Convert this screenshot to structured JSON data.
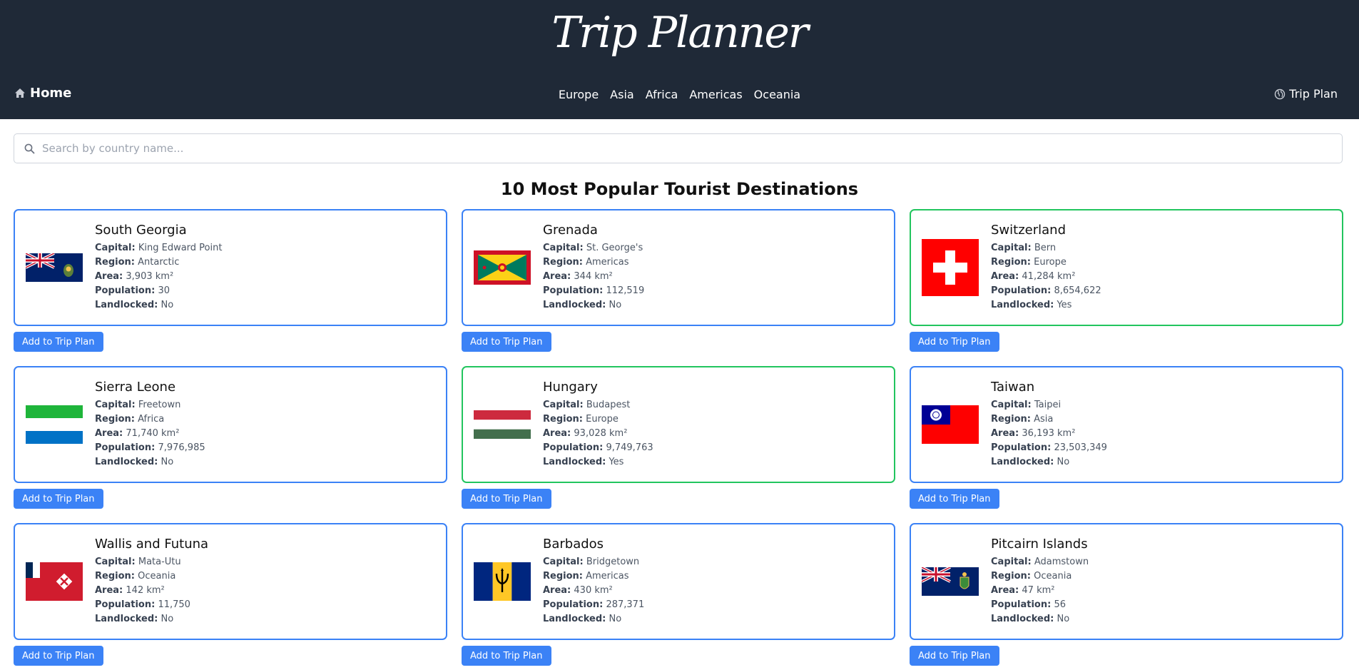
{
  "header": {
    "brand": "Trip Planner",
    "home_label": "Home",
    "nav": [
      "Europe",
      "Asia",
      "Africa",
      "Americas",
      "Oceania"
    ],
    "trip_plan_label": "Trip Plan"
  },
  "search": {
    "placeholder": "Search by country name..."
  },
  "section_title": "10 Most Popular Tourist Destinations",
  "field_labels": {
    "capital": "Capital:",
    "region": "Region:",
    "area": "Area:",
    "population": "Population:",
    "landlocked": "Landlocked:"
  },
  "add_button_label": "Add to Trip Plan",
  "colors": {
    "header_bg": "#1f2937",
    "accent_blue": "#3b82f6",
    "accent_green": "#22c55e"
  },
  "countries": [
    {
      "name": "South Georgia",
      "capital": "King Edward Point",
      "region": "Antarctic",
      "area": "3,903 km²",
      "population": "30",
      "landlocked": "No"
    },
    {
      "name": "Grenada",
      "capital": "St. George's",
      "region": "Americas",
      "area": "344 km²",
      "population": "112,519",
      "landlocked": "No"
    },
    {
      "name": "Switzerland",
      "capital": "Bern",
      "region": "Europe",
      "area": "41,284 km²",
      "population": "8,654,622",
      "landlocked": "Yes"
    },
    {
      "name": "Sierra Leone",
      "capital": "Freetown",
      "region": "Africa",
      "area": "71,740 km²",
      "population": "7,976,985",
      "landlocked": "No"
    },
    {
      "name": "Hungary",
      "capital": "Budapest",
      "region": "Europe",
      "area": "93,028 km²",
      "population": "9,749,763",
      "landlocked": "Yes"
    },
    {
      "name": "Taiwan",
      "capital": "Taipei",
      "region": "Asia",
      "area": "36,193 km²",
      "population": "23,503,349",
      "landlocked": "No"
    },
    {
      "name": "Wallis and Futuna",
      "capital": "Mata-Utu",
      "region": "Oceania",
      "area": "142 km²",
      "population": "11,750",
      "landlocked": "No"
    },
    {
      "name": "Barbados",
      "capital": "Bridgetown",
      "region": "Americas",
      "area": "430 km²",
      "population": "287,371",
      "landlocked": "No"
    },
    {
      "name": "Pitcairn Islands",
      "capital": "Adamstown",
      "region": "Oceania",
      "area": "47 km²",
      "population": "56",
      "landlocked": "No"
    }
  ]
}
